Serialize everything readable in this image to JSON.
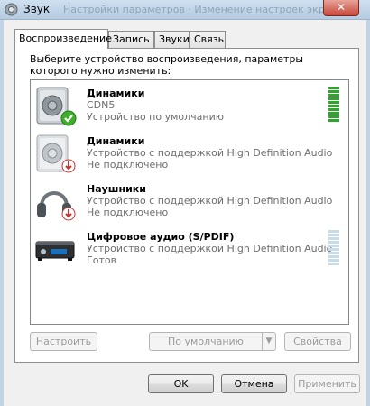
{
  "window": {
    "title": "Звук",
    "background_tabs_text": "Настройки параметров · Изменение настроек экрана",
    "close_glyph": "✕"
  },
  "tabs": [
    {
      "label": "Воспроизведение",
      "active": true
    },
    {
      "label": "Запись",
      "active": false
    },
    {
      "label": "Звуки",
      "active": false
    },
    {
      "label": "Связь",
      "active": false
    }
  ],
  "instruction": "Выберите устройство воспроизведения, параметры которого нужно изменить:",
  "devices": [
    {
      "name": "Динамики",
      "line2": "CDN5",
      "line3": "Устройство по умолчанию",
      "icon": "speaker-icon",
      "status": "default-check",
      "level": 1.0
    },
    {
      "name": "Динамики",
      "line2": "Устройство с поддержкой High Definition Audio",
      "line3": "Не подключено",
      "icon": "speaker-icon",
      "status": "disconnected",
      "level": 0
    },
    {
      "name": "Наушники",
      "line2": "Устройство с поддержкой High Definition Audio",
      "line3": "Не подключено",
      "icon": "headphones-icon",
      "status": "disconnected",
      "level": 0
    },
    {
      "name": "Цифровое аудио (S/PDIF)",
      "line2": "Устройство с поддержкой High Definition Audio",
      "line3": "Готов",
      "icon": "spdif-device-icon",
      "status": "ready",
      "level": 0
    }
  ],
  "buttons": {
    "configure": "Настроить",
    "set_default": "По умолчанию",
    "properties": "Свойства",
    "ok": "OK",
    "cancel": "Отмена",
    "apply": "Применить"
  },
  "colors": {
    "meter_active": "#2fa52f",
    "meter_idle": "#c8dce8",
    "check_green": "#3fae2b",
    "disconnect_red": "#c53232"
  }
}
